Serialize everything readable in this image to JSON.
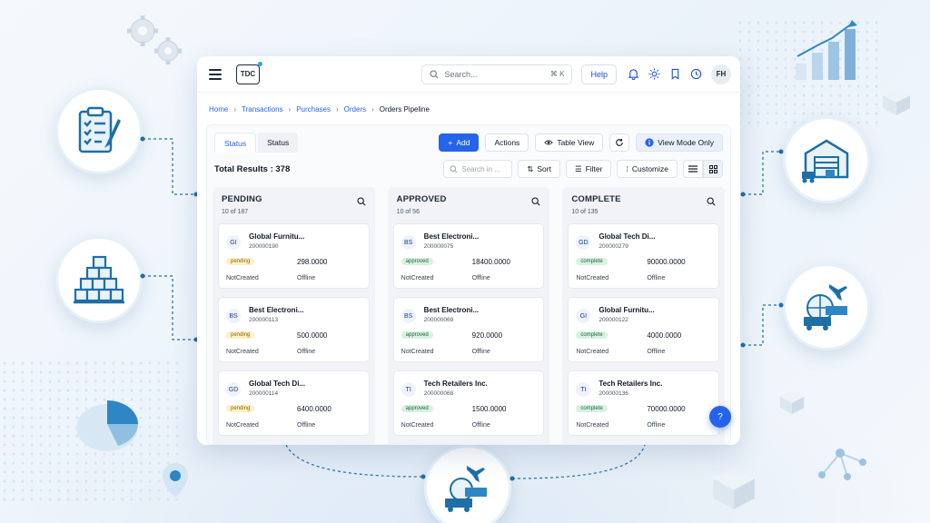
{
  "header": {
    "logo_text": "TDC",
    "search_placeholder": "Search...",
    "search_shortcut": "⌘ K",
    "help_label": "Help",
    "avatar_initials": "FH"
  },
  "breadcrumb": [
    "Home",
    "Transactions",
    "Purchases",
    "Orders",
    "Orders Pipeline"
  ],
  "tabs": [
    "Status",
    "Status"
  ],
  "toolbar": {
    "add_label": "Add",
    "actions_label": "Actions",
    "table_view_label": "Table View",
    "view_mode_label": "View Mode Only",
    "total_results": "Total Results : 378",
    "search_in_placeholder": "Search in ...",
    "sort_label": "Sort",
    "filter_label": "Filter",
    "customize_label": "Customize"
  },
  "columns": [
    {
      "title": "PENDING",
      "count": "10 of 187",
      "cards": [
        {
          "initials": "GI",
          "name": "Global Furnitu...",
          "id": "200000190",
          "status": "pending",
          "amount": "298.0000",
          "created": "NotCreated",
          "mode": "Offline"
        },
        {
          "initials": "BS",
          "name": "Best Electroni...",
          "id": "200000113",
          "status": "pending",
          "amount": "500.0000",
          "created": "NotCreated",
          "mode": "Offline"
        },
        {
          "initials": "GD",
          "name": "Global Tech Di...",
          "id": "200000114",
          "status": "pending",
          "amount": "6400.0000",
          "created": "NotCreated",
          "mode": "Offline"
        }
      ]
    },
    {
      "title": "APPROVED",
      "count": "10 of 56",
      "cards": [
        {
          "initials": "BS",
          "name": "Best Electroni...",
          "id": "200000075",
          "status": "approved",
          "amount": "18400.0000",
          "created": "NotCreated",
          "mode": "Offline"
        },
        {
          "initials": "BS",
          "name": "Best Electroni...",
          "id": "200000069",
          "status": "approved",
          "amount": "920.0000",
          "created": "NotCreated",
          "mode": "Offline"
        },
        {
          "initials": "TI",
          "name": "Tech Retailers Inc.",
          "id": "200000068",
          "status": "approved",
          "amount": "1500.0000",
          "created": "NotCreated",
          "mode": "Offline"
        }
      ]
    },
    {
      "title": "COMPLETE",
      "count": "10 of 135",
      "cards": [
        {
          "initials": "GD",
          "name": "Global Tech Di...",
          "id": "200000279",
          "status": "complete",
          "amount": "90000.0000",
          "created": "NotCreated",
          "mode": "Offline"
        },
        {
          "initials": "GI",
          "name": "Global Furnitu...",
          "id": "200000122",
          "status": "complete",
          "amount": "4000.0000",
          "created": "NotCreated",
          "mode": "Offline"
        },
        {
          "initials": "TI",
          "name": "Tech Retailers Inc.",
          "id": "200000136",
          "status": "complete",
          "amount": "70000.0000",
          "created": "NotCreated",
          "mode": "Offline"
        }
      ]
    }
  ],
  "fab_label": "?",
  "colors": {
    "primary": "#2563eb",
    "accent": "#1e6fa6",
    "pending": "#fdf0c5",
    "approved": "#d8f1e1"
  },
  "icons": [
    "gear-icon",
    "clipboard-icon",
    "boxes-icon",
    "warehouse-icon",
    "logistics-icon",
    "bar-chart-icon",
    "pie-chart-icon",
    "map-pin-icon",
    "cube-icon",
    "network-icon"
  ]
}
